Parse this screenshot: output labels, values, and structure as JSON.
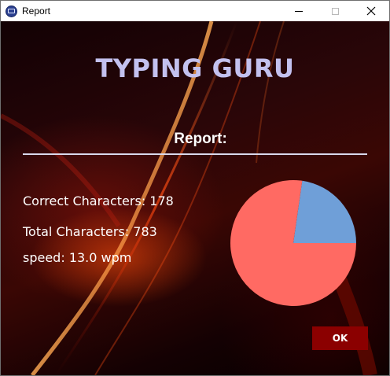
{
  "window": {
    "title": "Report",
    "controls": {
      "minimize": "minimize-icon",
      "maximize": "maximize-icon",
      "close": "close-icon"
    }
  },
  "app": {
    "title": "TYPING GURU"
  },
  "report": {
    "heading": "Report:",
    "correct_characters": "Correct Characters: 178",
    "total_characters": "Total Characters: 783",
    "speed": "speed: 13.0 wpm"
  },
  "chart_data": {
    "type": "pie",
    "slices": [
      {
        "value": 178,
        "color": "#6f9fd8"
      },
      {
        "value": 605,
        "color": "#ff6a63"
      }
    ]
  },
  "buttons": {
    "ok": "OK"
  },
  "colors": {
    "title_text": "#c3c1ef",
    "button_bg": "#8b0000",
    "pie_correct": "#6f9fd8",
    "pie_rest": "#ff6a63"
  }
}
